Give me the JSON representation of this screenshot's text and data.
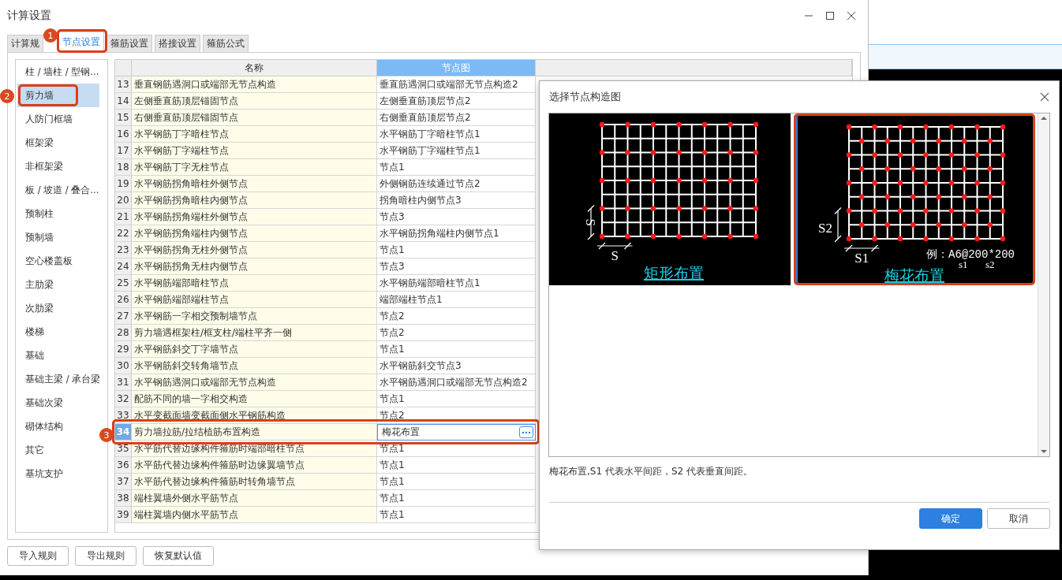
{
  "window": {
    "title": "计算设置"
  },
  "tabs": [
    {
      "label": "计算规",
      "selected": false
    },
    {
      "label": "节点设置",
      "selected": true,
      "annotation": "1"
    },
    {
      "label": "箍筋设置",
      "selected": false
    },
    {
      "label": "搭接设置",
      "selected": false
    },
    {
      "label": "箍筋公式",
      "selected": false
    }
  ],
  "sidebar": {
    "items": [
      {
        "label": "柱 / 墙柱 / 型钢...",
        "selected": false
      },
      {
        "label": "剪力墙",
        "selected": true,
        "annotation": "2"
      },
      {
        "label": "人防门框墙",
        "selected": false
      },
      {
        "label": "框架梁",
        "selected": false
      },
      {
        "label": "非框架梁",
        "selected": false
      },
      {
        "label": "板 / 坡道 / 叠合...",
        "selected": false
      },
      {
        "label": "预制柱",
        "selected": false
      },
      {
        "label": "预制墙",
        "selected": false
      },
      {
        "label": "空心楼盖板",
        "selected": false
      },
      {
        "label": "主肋梁",
        "selected": false
      },
      {
        "label": "次肋梁",
        "selected": false
      },
      {
        "label": "楼梯",
        "selected": false
      },
      {
        "label": "基础",
        "selected": false
      },
      {
        "label": "基础主梁 / 承台梁",
        "selected": false
      },
      {
        "label": "基础次梁",
        "selected": false
      },
      {
        "label": "砌体结构",
        "selected": false
      },
      {
        "label": "其它",
        "selected": false
      },
      {
        "label": "基坑支护",
        "selected": false
      }
    ]
  },
  "table": {
    "columns": [
      {
        "label": "名称",
        "selected": false
      },
      {
        "label": "节点图",
        "selected": true
      }
    ],
    "rows": [
      {
        "number": "13",
        "name": "垂直钢筋遇洞口或端部无节点构造",
        "node": "垂直筋遇洞口或端部无节点构造2",
        "selected": false
      },
      {
        "number": "14",
        "name": "左侧垂直筋顶层锚固节点",
        "node": "左侧垂直筋顶层节点2",
        "selected": false
      },
      {
        "number": "15",
        "name": "右侧垂直筋顶层锚固节点",
        "node": "右侧垂直筋顶层节点2",
        "selected": false
      },
      {
        "number": "16",
        "name": "水平钢筋丁字暗柱节点",
        "node": "水平钢筋丁字暗柱节点1",
        "selected": false
      },
      {
        "number": "17",
        "name": "水平钢筋丁字端柱节点",
        "node": "水平钢筋丁字端柱节点1",
        "selected": false
      },
      {
        "number": "18",
        "name": "水平钢筋丁字无柱节点",
        "node": "节点1",
        "selected": false
      },
      {
        "number": "19",
        "name": "水平钢筋拐角暗柱外侧节点",
        "node": "外侧钢筋连续通过节点2",
        "selected": false
      },
      {
        "number": "20",
        "name": "水平钢筋拐角暗柱内侧节点",
        "node": "拐角暗柱内侧节点3",
        "selected": false
      },
      {
        "number": "21",
        "name": "水平钢筋拐角端柱外侧节点",
        "node": "节点3",
        "selected": false
      },
      {
        "number": "22",
        "name": "水平钢筋拐角端柱内侧节点",
        "node": "水平钢筋拐角端柱内侧节点1",
        "selected": false
      },
      {
        "number": "23",
        "name": "水平钢筋拐角无柱外侧节点",
        "node": "节点1",
        "selected": false
      },
      {
        "number": "24",
        "name": "水平钢筋拐角无柱内侧节点",
        "node": "节点3",
        "selected": false
      },
      {
        "number": "25",
        "name": "水平钢筋端部暗柱节点",
        "node": "水平钢筋端部暗柱节点1",
        "selected": false
      },
      {
        "number": "26",
        "name": "水平钢筋端部端柱节点",
        "node": "端部端柱节点1",
        "selected": false
      },
      {
        "number": "27",
        "name": "水平钢筋一字相交预制墙节点",
        "node": "节点2",
        "selected": false
      },
      {
        "number": "28",
        "name": "剪力墙遇框架柱/框支柱/端柱平齐一侧",
        "node": "节点2",
        "selected": false
      },
      {
        "number": "29",
        "name": "水平钢筋斜交丁字墙节点",
        "node": "节点1",
        "selected": false
      },
      {
        "number": "30",
        "name": "水平钢筋斜交转角墙节点",
        "node": "水平钢筋斜交节点3",
        "selected": false
      },
      {
        "number": "31",
        "name": "水平钢筋遇洞口或端部无节点构造",
        "node": "水平钢筋遇洞口或端部无节点构造2",
        "selected": false
      },
      {
        "number": "32",
        "name": "配筋不同的墙一字相交构造",
        "node": "节点1",
        "selected": false
      },
      {
        "number": "33",
        "name": "水平变截面墙变截面侧水平钢筋构造",
        "node": "节点2",
        "selected": false
      },
      {
        "number": "34",
        "name": "剪力墙拉筋/拉结植筋布置构造",
        "node": "梅花布置",
        "selected": true,
        "annotation": "3"
      },
      {
        "number": "35",
        "name": "水平筋代替边缘构件箍筋时端部暗柱节点",
        "node": "节点1",
        "selected": false
      },
      {
        "number": "36",
        "name": "水平筋代替边缘构件箍筋时边缘翼墙节点",
        "node": "节点1",
        "selected": false
      },
      {
        "number": "37",
        "name": "水平筋代替边缘构件箍筋时转角墙节点",
        "node": "节点1",
        "selected": false
      },
      {
        "number": "38",
        "name": "端柱翼墙外侧水平筋节点",
        "node": "节点1",
        "selected": false
      },
      {
        "number": "39",
        "name": "端柱翼墙内侧水平筋节点",
        "node": "节点1",
        "selected": false
      }
    ]
  },
  "buttons": [
    "导入规则",
    "导出规则",
    "恢复默认值"
  ],
  "dialog": {
    "title": "选择节点构造图",
    "options": [
      {
        "kind": "rect",
        "caption": "矩形布置",
        "dim_v": "S",
        "dim_h": "S",
        "selected": false
      },
      {
        "kind": "staggered",
        "caption": "梅花布置",
        "dim_v": "S2",
        "dim_h": "S1",
        "example": "例：A6@200*200",
        "marks": [
          "s1",
          "s2"
        ],
        "selected": true
      }
    ],
    "description": "梅花布置,S1 代表水平间距，S2 代表垂直间距。",
    "buttons": [
      {
        "label": "确定",
        "kind": "primary"
      },
      {
        "label": "取消",
        "kind": "secondary"
      }
    ]
  }
}
